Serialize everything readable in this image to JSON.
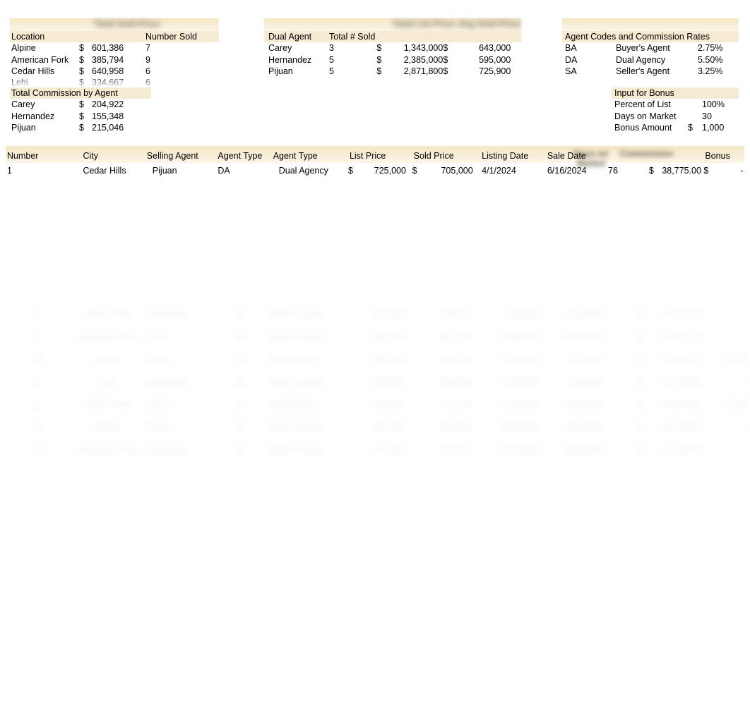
{
  "summary_by_location": {
    "title_blurred": "Total Sold Price",
    "headers": [
      "Location",
      "",
      "",
      "Number Sold"
    ],
    "rows": [
      {
        "location": "Alpine",
        "currency": "$",
        "amount": "601,386",
        "number_sold": "7"
      },
      {
        "location": "American Fork",
        "currency": "$",
        "amount": "385,794",
        "number_sold": "9"
      },
      {
        "location": "Cedar Hills",
        "currency": "$",
        "amount": "640,958",
        "number_sold": "6"
      },
      {
        "location": "Lehi",
        "currency": "$",
        "amount": "334,667",
        "number_sold": "6"
      }
    ]
  },
  "commission_by_agent": {
    "title": "Total Commission by Agent",
    "rows": [
      {
        "agent": "Carey",
        "currency": "$",
        "amount": "204,922"
      },
      {
        "agent": "Hernandez",
        "currency": "$",
        "amount": "155,348"
      },
      {
        "agent": "Pijuan",
        "currency": "$",
        "amount": "215,046"
      }
    ]
  },
  "dual_agent_summary": {
    "headers": [
      "Dual Agent",
      "Total # Sold",
      "",
      ""
    ],
    "header_blurred_1": "Total List Price",
    "header_blurred_2": "Avg Sold Price",
    "rows": [
      {
        "agent": "Carey",
        "total_sold": "3",
        "cur1": "$",
        "total_list": "1,343,000",
        "cur2": "$",
        "avg_sold": "643,000"
      },
      {
        "agent": "Hernandez",
        "total_sold": "5",
        "cur1": "$",
        "total_list": "2,385,000",
        "cur2": "$",
        "avg_sold": "595,000"
      },
      {
        "agent": "Pijuan",
        "total_sold": "5",
        "cur1": "$",
        "total_list": "2,871,800",
        "cur2": "$",
        "avg_sold": "725,900"
      }
    ]
  },
  "agent_codes": {
    "title": "Agent Codes and Commission Rates",
    "rows": [
      {
        "code": "BA",
        "name": "Buyer's Agent",
        "rate": "2.75%"
      },
      {
        "code": "DA",
        "name": "Dual Agency",
        "rate": "5.50%"
      },
      {
        "code": "SA",
        "name": "Seller's Agent",
        "rate": "3.25%"
      }
    ]
  },
  "input_for_bonus": {
    "title": "Input for Bonus",
    "rows": [
      {
        "label": "Percent of List",
        "currency": "",
        "value": "100%"
      },
      {
        "label": "Days on Market",
        "currency": "",
        "value": "30"
      },
      {
        "label": "Bonus Amount",
        "currency": "$",
        "value": "1,000"
      }
    ]
  },
  "main_table": {
    "headers": [
      "Number",
      "City",
      "Selling Agent",
      "Agent Type",
      "Agent Type",
      "List Price",
      "Sold Price",
      "Listing Date",
      "Sale Date",
      "",
      "",
      "Bonus"
    ],
    "header_blurred_1": "Days on Market",
    "header_blurred_2": "Commission",
    "rows": [
      {
        "number": "1",
        "city": "Cedar Hills",
        "selling_agent": "Pijuan",
        "agent_code": "DA",
        "agent_type": "Dual Agency",
        "list_cur": "$",
        "list_price": "725,000",
        "sold_cur": "$",
        "sold_price": "705,000",
        "listing_date": "4/1/2024",
        "sale_date": "6/16/2024",
        "days_on_market": "76",
        "comm_cur": "$",
        "commission": "38,775.00",
        "bonus_cur": "$",
        "bonus": "-"
      }
    ]
  },
  "ghost_rows": {
    "note": "illegible faded rows",
    "lines": [
      [
        "2",
        "",
        "",
        "",
        "",
        "",
        "",
        "",
        "",
        "",
        "",
        ""
      ],
      [
        "3",
        "",
        "",
        "",
        "",
        "",
        "",
        "",
        "",
        "",
        "",
        ""
      ],
      [
        "4",
        "",
        "",
        "",
        "",
        "",
        "",
        "",
        "",
        "",
        "",
        ""
      ],
      [
        "5",
        "",
        "",
        "",
        "",
        "",
        "",
        "",
        "",
        "",
        "",
        ""
      ],
      [
        "6",
        "",
        "",
        "",
        "",
        "",
        "",
        "",
        "",
        "",
        "",
        ""
      ],
      [
        "7",
        "",
        "",
        "",
        "",
        "",
        "",
        "",
        "",
        "",
        "",
        ""
      ],
      [
        "8",
        "",
        "",
        "",
        "",
        "",
        "",
        "",
        "",
        "",
        "",
        ""
      ]
    ]
  },
  "colors": {
    "header_band": "#f4e7c4",
    "page_background": "#ffffff",
    "text": "#000000",
    "ghost_text": "#8e8e8e"
  }
}
